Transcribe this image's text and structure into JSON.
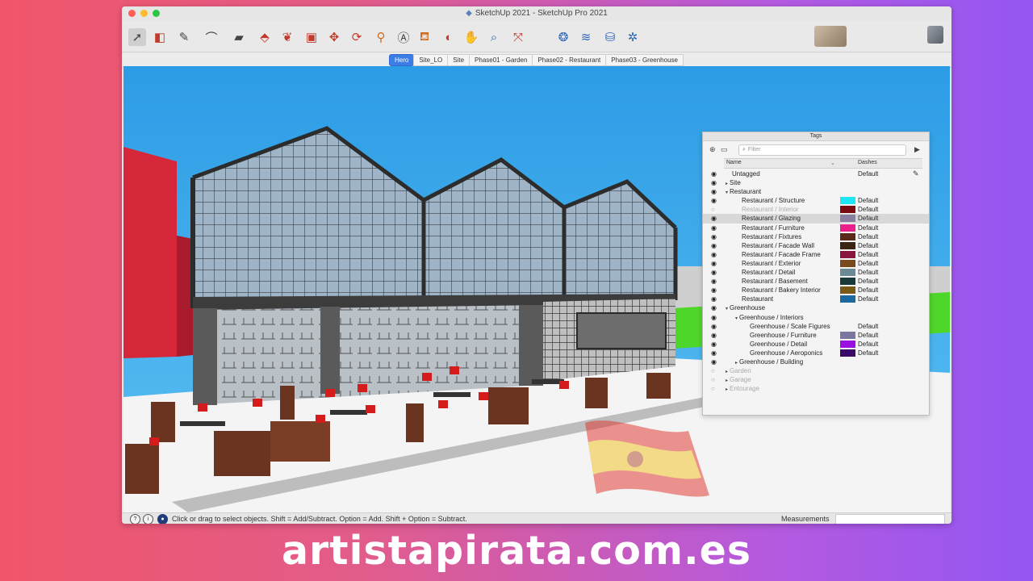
{
  "window": {
    "title": "SketchUp 2021 - SketchUp Pro 2021"
  },
  "toolbar": {
    "tools": [
      "select-icon",
      "eraser-icon",
      "pencil-icon",
      "arc-icon",
      "rectangle-icon",
      "push-pull-icon",
      "follow-me-icon",
      "offset-icon",
      "move-icon",
      "rotate-icon",
      "tape-measure-icon",
      "text-icon",
      "paint-bucket-icon",
      "orbit-icon",
      "pan-icon",
      "zoom-icon",
      "zoom-extents-icon",
      "warehouse-icon",
      "extension-icon",
      "layout-icon",
      "style-builder-icon"
    ]
  },
  "scene_tabs": [
    {
      "label": "Hero",
      "active": true
    },
    {
      "label": "Site_LO",
      "active": false
    },
    {
      "label": "Site",
      "active": false
    },
    {
      "label": "Phase01 - Garden",
      "active": false
    },
    {
      "label": "Phase02 - Restaurant",
      "active": false
    },
    {
      "label": "Phase03 - Greenhouse",
      "active": false
    }
  ],
  "tags_panel": {
    "title": "Tags",
    "filter_placeholder": "Filter",
    "col_name": "Name",
    "col_dashes": "Dashes",
    "rows": [
      {
        "name": "Untagged",
        "indent": 0,
        "tri": "",
        "visible": true,
        "color": "",
        "dashes": "Default",
        "pencil": true,
        "selected": false,
        "dim": false
      },
      {
        "name": "Site",
        "indent": 0,
        "tri": "▸",
        "visible": true,
        "color": "",
        "dashes": "",
        "pencil": false,
        "selected": false,
        "dim": false
      },
      {
        "name": "Restaurant",
        "indent": 0,
        "tri": "▾",
        "visible": true,
        "color": "",
        "dashes": "",
        "pencil": false,
        "selected": false,
        "dim": false
      },
      {
        "name": "Restaurant / Structure",
        "indent": 1,
        "tri": "",
        "visible": true,
        "color": "#1ee6f5",
        "dashes": "Default",
        "pencil": false,
        "selected": false,
        "dim": false
      },
      {
        "name": "Restaurant / Interior",
        "indent": 1,
        "tri": "",
        "visible": false,
        "color": "#7a0a12",
        "dashes": "Default",
        "pencil": false,
        "selected": false,
        "dim": true
      },
      {
        "name": "Restaurant / Glazing",
        "indent": 1,
        "tri": "",
        "visible": true,
        "color": "#8a7ea0",
        "dashes": "Default",
        "pencil": false,
        "selected": true,
        "dim": false
      },
      {
        "name": "Restaurant / Furniture",
        "indent": 1,
        "tri": "",
        "visible": true,
        "color": "#ea1f8c",
        "dashes": "Default",
        "pencil": false,
        "selected": false,
        "dim": false
      },
      {
        "name": "Restaurant / Fixtures",
        "indent": 1,
        "tri": "",
        "visible": true,
        "color": "#5a2a1a",
        "dashes": "Default",
        "pencil": false,
        "selected": false,
        "dim": false
      },
      {
        "name": "Restaurant / Facade Wall",
        "indent": 1,
        "tri": "",
        "visible": true,
        "color": "#3a2414",
        "dashes": "Default",
        "pencil": false,
        "selected": false,
        "dim": false
      },
      {
        "name": "Restaurant / Facade Frame",
        "indent": 1,
        "tri": "",
        "visible": true,
        "color": "#8a1440",
        "dashes": "Default",
        "pencil": false,
        "selected": false,
        "dim": false
      },
      {
        "name": "Restaurant / Exterior",
        "indent": 1,
        "tri": "",
        "visible": true,
        "color": "#7a4a1e",
        "dashes": "Default",
        "pencil": false,
        "selected": false,
        "dim": false
      },
      {
        "name": "Restaurant / Detail",
        "indent": 1,
        "tri": "",
        "visible": true,
        "color": "#6a8a96",
        "dashes": "Default",
        "pencil": false,
        "selected": false,
        "dim": false
      },
      {
        "name": "Restaurant / Basement",
        "indent": 1,
        "tri": "",
        "visible": true,
        "color": "#1a3a3a",
        "dashes": "Default",
        "pencil": false,
        "selected": false,
        "dim": false
      },
      {
        "name": "Restaurant / Bakery Interior",
        "indent": 1,
        "tri": "",
        "visible": true,
        "color": "#7a5a14",
        "dashes": "Default",
        "pencil": false,
        "selected": false,
        "dim": false
      },
      {
        "name": "Restaurant",
        "indent": 1,
        "tri": "",
        "visible": true,
        "color": "#1a6aa0",
        "dashes": "Default",
        "pencil": false,
        "selected": false,
        "dim": false
      },
      {
        "name": "Greenhouse",
        "indent": 0,
        "tri": "▾",
        "visible": true,
        "color": "",
        "dashes": "",
        "pencil": false,
        "selected": false,
        "dim": false
      },
      {
        "name": "Greenhouse / Interiors",
        "indent": 1,
        "tri": "▾",
        "visible": true,
        "color": "",
        "dashes": "",
        "pencil": false,
        "selected": false,
        "dim": false
      },
      {
        "name": "Greenhouse / Scale Figures",
        "indent": 2,
        "tri": "",
        "visible": true,
        "color": "",
        "dashes": "Default",
        "pencil": false,
        "selected": false,
        "dim": false
      },
      {
        "name": "Greenhouse / Furniture",
        "indent": 2,
        "tri": "",
        "visible": true,
        "color": "#7a78a0",
        "dashes": "Default",
        "pencil": false,
        "selected": false,
        "dim": false
      },
      {
        "name": "Greenhouse / Detail",
        "indent": 2,
        "tri": "",
        "visible": true,
        "color": "#9a10e0",
        "dashes": "Default",
        "pencil": false,
        "selected": false,
        "dim": false
      },
      {
        "name": "Greenhouse / Aeroponics",
        "indent": 2,
        "tri": "",
        "visible": true,
        "color": "#3a0a6a",
        "dashes": "Default",
        "pencil": false,
        "selected": false,
        "dim": false
      },
      {
        "name": "Greenhouse / Building",
        "indent": 1,
        "tri": "▸",
        "visible": true,
        "color": "",
        "dashes": "",
        "pencil": false,
        "selected": false,
        "dim": false
      },
      {
        "name": "Garden",
        "indent": 0,
        "tri": "▸",
        "visible": false,
        "color": "",
        "dashes": "",
        "pencil": false,
        "selected": false,
        "dim": true
      },
      {
        "name": "Garage",
        "indent": 0,
        "tri": "▸",
        "visible": false,
        "color": "",
        "dashes": "",
        "pencil": false,
        "selected": false,
        "dim": true
      },
      {
        "name": "Entourage",
        "indent": 0,
        "tri": "▸",
        "visible": false,
        "color": "",
        "dashes": "",
        "pencil": false,
        "selected": false,
        "dim": true
      }
    ]
  },
  "statusbar": {
    "hint": "Click or drag to select objects. Shift = Add/Subtract. Option = Add. Shift + Option = Subtract.",
    "measurements_label": "Measurements",
    "measurements_value": ""
  },
  "watermark": {
    "text": "artistapirata.com.es"
  },
  "colors": {
    "sky": "#2fa2e6",
    "accent_tab": "#3d7de6",
    "wall_red": "#d6263a",
    "frame_dark": "#3c3c3c",
    "chair_red": "#d41c1c",
    "planter_brown": "#6b3420",
    "grass": "#4fd62a"
  }
}
